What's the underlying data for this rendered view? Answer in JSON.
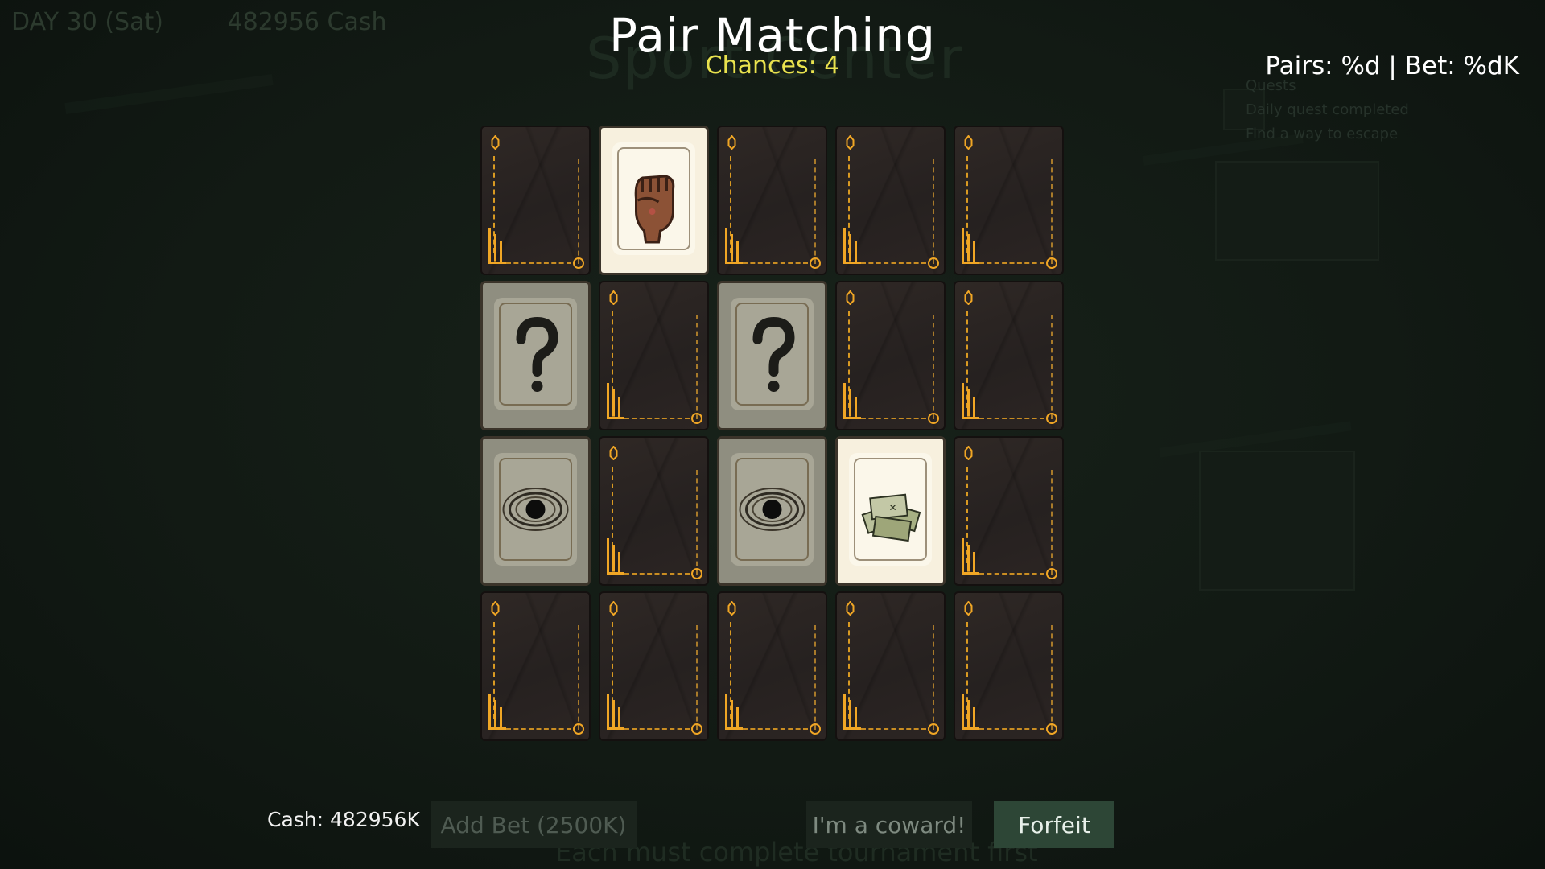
{
  "hud": {
    "day": "DAY 30 (Sat)",
    "cash": "482956 Cash"
  },
  "background": {
    "arena_title": "Sport Center",
    "quest_title": "Quests",
    "quests": [
      "Daily quest completed",
      "Find a way to escape"
    ],
    "footer_hint": "Each must complete tournament first"
  },
  "title": "Pair Matching",
  "chances": "Chances: 4",
  "pairs_bet": "Pairs: %d | Bet: %dK",
  "cards": [
    {
      "state": "back"
    },
    {
      "state": "face",
      "art": "fist-icon",
      "tone": "bright"
    },
    {
      "state": "back"
    },
    {
      "state": "back"
    },
    {
      "state": "back"
    },
    {
      "state": "face",
      "art": "question-mark-icon",
      "tone": "dim"
    },
    {
      "state": "back"
    },
    {
      "state": "face",
      "art": "question-mark-icon",
      "tone": "dim"
    },
    {
      "state": "back"
    },
    {
      "state": "back"
    },
    {
      "state": "face",
      "art": "black-hole-icon",
      "tone": "dim"
    },
    {
      "state": "back"
    },
    {
      "state": "face",
      "art": "black-hole-icon",
      "tone": "dim"
    },
    {
      "state": "face",
      "art": "cash-pile-icon",
      "tone": "bright"
    },
    {
      "state": "back"
    },
    {
      "state": "back"
    },
    {
      "state": "back"
    },
    {
      "state": "back"
    },
    {
      "state": "back"
    },
    {
      "state": "back"
    }
  ],
  "bottom": {
    "cash": "Cash: 482956K",
    "add_bet": "Add Bet (2500K)",
    "coward": "I'm a coward!",
    "forfeit": "Forfeit"
  },
  "colors": {
    "accent_gold": "#f0a625",
    "chances_yellow": "#e9e24e",
    "forfeit_bg": "#2d4636"
  }
}
